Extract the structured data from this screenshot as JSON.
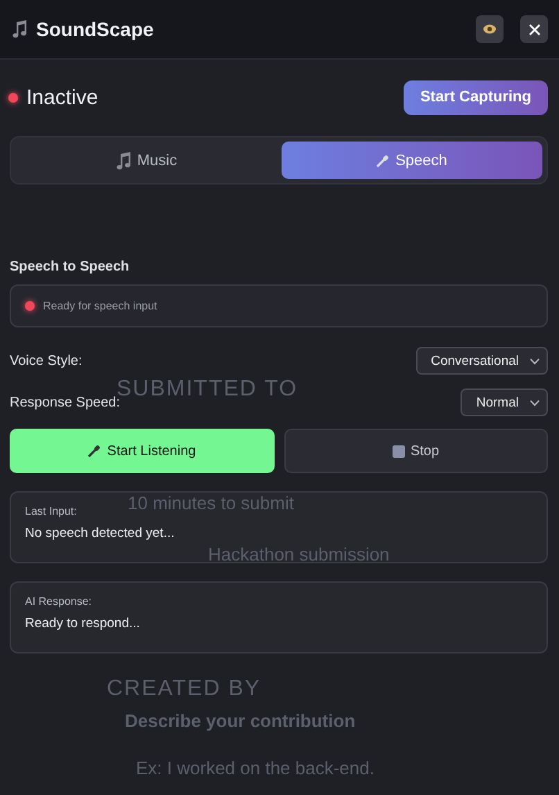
{
  "background_page": {
    "texts": [
      {
        "kind": "heading",
        "text": "SUBMITTED TO"
      },
      {
        "kind": "line",
        "text": "10 minutes to submit"
      },
      {
        "kind": "line",
        "text": "Hackathon submission"
      },
      {
        "kind": "heading",
        "text": "CREATED BY"
      },
      {
        "kind": "label",
        "text": "Describe your contribution"
      },
      {
        "kind": "line",
        "text": "Ex: I worked on the back-end."
      }
    ]
  },
  "window": {
    "title": "SoundScape"
  },
  "status": {
    "label": "Inactive",
    "active": false
  },
  "capture_button": "Start Capturing",
  "tabs": [
    {
      "label": "Music",
      "selected": false
    },
    {
      "label": "Speech",
      "selected": true
    }
  ],
  "section_title": "Speech to Speech",
  "speech_status": {
    "text": "Ready for speech input",
    "active": false
  },
  "settings": [
    {
      "label": "Voice Style:",
      "value": "Conversational"
    },
    {
      "label": "Response Speed:",
      "value": "Normal"
    }
  ],
  "buttons": [
    {
      "kind": "start",
      "label": "Start Listening"
    },
    {
      "kind": "stop",
      "label": "Stop"
    }
  ],
  "cards": [
    {
      "title": "Last Input:",
      "text": "No speech detected yet..."
    },
    {
      "title": "AI Response:",
      "text": "Ready to respond..."
    }
  ]
}
